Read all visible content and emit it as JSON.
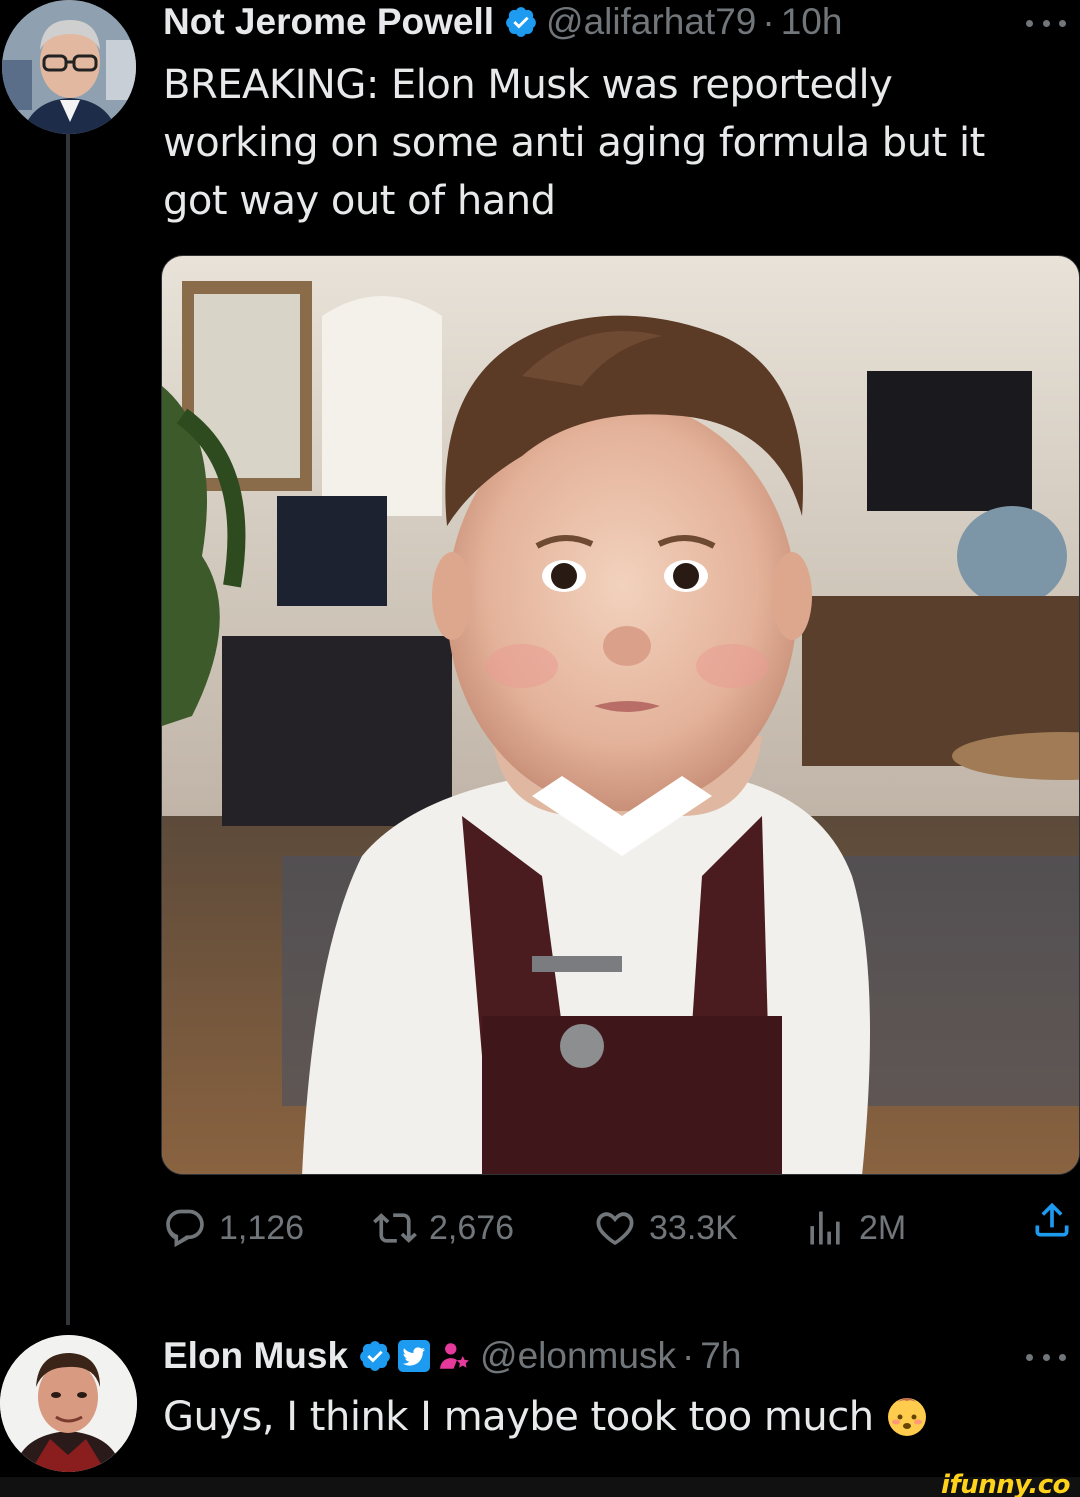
{
  "tweet_1": {
    "display_name": "Not Jerome Powell",
    "handle": "@alifarhat79",
    "separator": "·",
    "time": "10h",
    "text": "BREAKING: Elon Musk was reportedly working on some anti aging formula but it got way out of hand",
    "avatar_icon": "person-avatar",
    "verified_icon": "verified-badge-icon",
    "media_description_icon": "photo",
    "stats": {
      "replies": "1,126",
      "retweets": "2,676",
      "likes": "33.3K",
      "views": "2M"
    }
  },
  "tweet_2": {
    "display_name": "Elon Musk",
    "handle": "@elonmusk",
    "separator": "·",
    "time": "7h",
    "text": "Guys, I think I maybe took too much",
    "emoji": "baby-emoji"
  },
  "watermark": "ifunny.co",
  "colors": {
    "background": "#000000",
    "primary_text": "#e7e9ea",
    "secondary_text": "#71767b",
    "verified_blue": "#1d9bf0",
    "thread_line": "#333639",
    "watermark": "#ffd21c"
  }
}
